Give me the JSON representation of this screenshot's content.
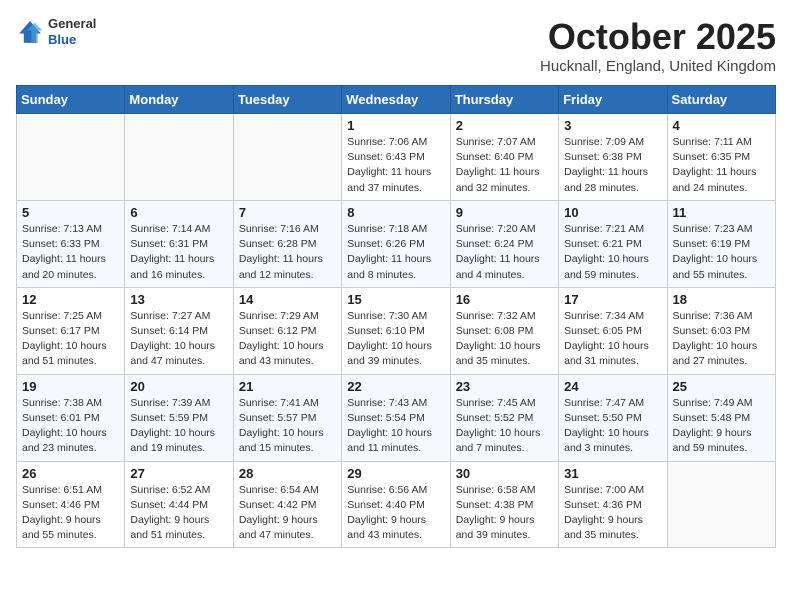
{
  "header": {
    "logo": {
      "general": "General",
      "blue": "Blue"
    },
    "title": "October 2025",
    "location": "Hucknall, England, United Kingdom"
  },
  "days_of_week": [
    "Sunday",
    "Monday",
    "Tuesday",
    "Wednesday",
    "Thursday",
    "Friday",
    "Saturday"
  ],
  "weeks": [
    [
      {
        "day": "",
        "info": ""
      },
      {
        "day": "",
        "info": ""
      },
      {
        "day": "",
        "info": ""
      },
      {
        "day": "1",
        "info": "Sunrise: 7:06 AM\nSunset: 6:43 PM\nDaylight: 11 hours\nand 37 minutes."
      },
      {
        "day": "2",
        "info": "Sunrise: 7:07 AM\nSunset: 6:40 PM\nDaylight: 11 hours\nand 32 minutes."
      },
      {
        "day": "3",
        "info": "Sunrise: 7:09 AM\nSunset: 6:38 PM\nDaylight: 11 hours\nand 28 minutes."
      },
      {
        "day": "4",
        "info": "Sunrise: 7:11 AM\nSunset: 6:35 PM\nDaylight: 11 hours\nand 24 minutes."
      }
    ],
    [
      {
        "day": "5",
        "info": "Sunrise: 7:13 AM\nSunset: 6:33 PM\nDaylight: 11 hours\nand 20 minutes."
      },
      {
        "day": "6",
        "info": "Sunrise: 7:14 AM\nSunset: 6:31 PM\nDaylight: 11 hours\nand 16 minutes."
      },
      {
        "day": "7",
        "info": "Sunrise: 7:16 AM\nSunset: 6:28 PM\nDaylight: 11 hours\nand 12 minutes."
      },
      {
        "day": "8",
        "info": "Sunrise: 7:18 AM\nSunset: 6:26 PM\nDaylight: 11 hours\nand 8 minutes."
      },
      {
        "day": "9",
        "info": "Sunrise: 7:20 AM\nSunset: 6:24 PM\nDaylight: 11 hours\nand 4 minutes."
      },
      {
        "day": "10",
        "info": "Sunrise: 7:21 AM\nSunset: 6:21 PM\nDaylight: 10 hours\nand 59 minutes."
      },
      {
        "day": "11",
        "info": "Sunrise: 7:23 AM\nSunset: 6:19 PM\nDaylight: 10 hours\nand 55 minutes."
      }
    ],
    [
      {
        "day": "12",
        "info": "Sunrise: 7:25 AM\nSunset: 6:17 PM\nDaylight: 10 hours\nand 51 minutes."
      },
      {
        "day": "13",
        "info": "Sunrise: 7:27 AM\nSunset: 6:14 PM\nDaylight: 10 hours\nand 47 minutes."
      },
      {
        "day": "14",
        "info": "Sunrise: 7:29 AM\nSunset: 6:12 PM\nDaylight: 10 hours\nand 43 minutes."
      },
      {
        "day": "15",
        "info": "Sunrise: 7:30 AM\nSunset: 6:10 PM\nDaylight: 10 hours\nand 39 minutes."
      },
      {
        "day": "16",
        "info": "Sunrise: 7:32 AM\nSunset: 6:08 PM\nDaylight: 10 hours\nand 35 minutes."
      },
      {
        "day": "17",
        "info": "Sunrise: 7:34 AM\nSunset: 6:05 PM\nDaylight: 10 hours\nand 31 minutes."
      },
      {
        "day": "18",
        "info": "Sunrise: 7:36 AM\nSunset: 6:03 PM\nDaylight: 10 hours\nand 27 minutes."
      }
    ],
    [
      {
        "day": "19",
        "info": "Sunrise: 7:38 AM\nSunset: 6:01 PM\nDaylight: 10 hours\nand 23 minutes."
      },
      {
        "day": "20",
        "info": "Sunrise: 7:39 AM\nSunset: 5:59 PM\nDaylight: 10 hours\nand 19 minutes."
      },
      {
        "day": "21",
        "info": "Sunrise: 7:41 AM\nSunset: 5:57 PM\nDaylight: 10 hours\nand 15 minutes."
      },
      {
        "day": "22",
        "info": "Sunrise: 7:43 AM\nSunset: 5:54 PM\nDaylight: 10 hours\nand 11 minutes."
      },
      {
        "day": "23",
        "info": "Sunrise: 7:45 AM\nSunset: 5:52 PM\nDaylight: 10 hours\nand 7 minutes."
      },
      {
        "day": "24",
        "info": "Sunrise: 7:47 AM\nSunset: 5:50 PM\nDaylight: 10 hours\nand 3 minutes."
      },
      {
        "day": "25",
        "info": "Sunrise: 7:49 AM\nSunset: 5:48 PM\nDaylight: 9 hours\nand 59 minutes."
      }
    ],
    [
      {
        "day": "26",
        "info": "Sunrise: 6:51 AM\nSunset: 4:46 PM\nDaylight: 9 hours\nand 55 minutes."
      },
      {
        "day": "27",
        "info": "Sunrise: 6:52 AM\nSunset: 4:44 PM\nDaylight: 9 hours\nand 51 minutes."
      },
      {
        "day": "28",
        "info": "Sunrise: 6:54 AM\nSunset: 4:42 PM\nDaylight: 9 hours\nand 47 minutes."
      },
      {
        "day": "29",
        "info": "Sunrise: 6:56 AM\nSunset: 4:40 PM\nDaylight: 9 hours\nand 43 minutes."
      },
      {
        "day": "30",
        "info": "Sunrise: 6:58 AM\nSunset: 4:38 PM\nDaylight: 9 hours\nand 39 minutes."
      },
      {
        "day": "31",
        "info": "Sunrise: 7:00 AM\nSunset: 4:36 PM\nDaylight: 9 hours\nand 35 minutes."
      },
      {
        "day": "",
        "info": ""
      }
    ]
  ]
}
